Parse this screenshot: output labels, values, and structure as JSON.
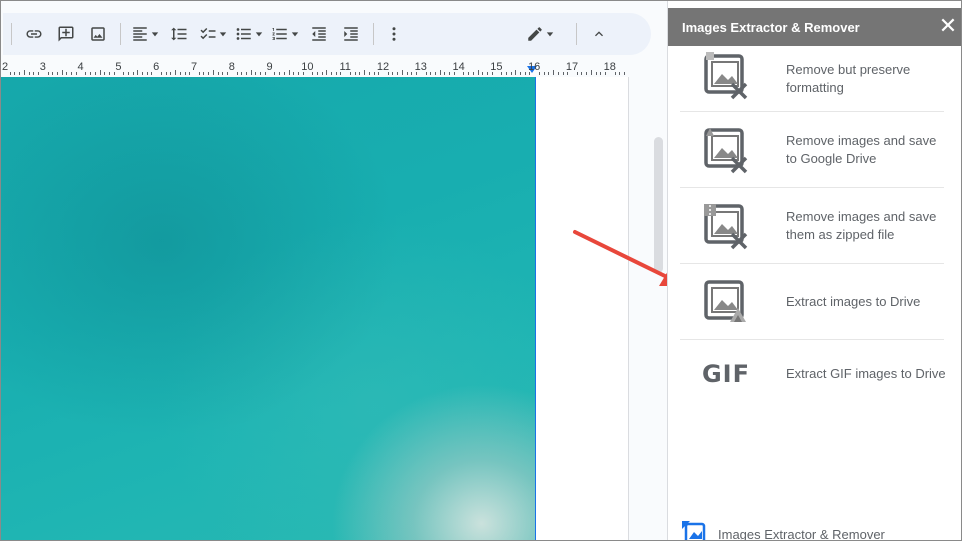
{
  "toolbar": {
    "buttons": [
      {
        "name": "insert-link-button",
        "icon": "link-icon"
      },
      {
        "name": "add-comment-button",
        "icon": "add-comment-icon"
      },
      {
        "name": "insert-image-button",
        "icon": "image-icon"
      },
      {
        "name": "align-button",
        "icon": "align-left-icon"
      },
      {
        "name": "line-spacing-button",
        "icon": "line-spacing-icon"
      },
      {
        "name": "checklist-button",
        "icon": "checklist-icon"
      },
      {
        "name": "bulleted-list-button",
        "icon": "bulleted-list-icon"
      },
      {
        "name": "numbered-list-button",
        "icon": "numbered-list-icon"
      },
      {
        "name": "decrease-indent-button",
        "icon": "decrease-indent-icon"
      },
      {
        "name": "increase-indent-button",
        "icon": "increase-indent-icon"
      },
      {
        "name": "more-options-button",
        "icon": "more-vert-icon"
      },
      {
        "name": "editing-mode-button",
        "icon": "pencil-icon"
      },
      {
        "name": "hide-menus-button",
        "icon": "chevron-up-icon"
      }
    ]
  },
  "ruler": {
    "labels": [
      "2",
      "3",
      "4",
      "5",
      "6",
      "7",
      "8",
      "9",
      "10",
      "11",
      "12",
      "13",
      "14",
      "15",
      "16",
      "17",
      "18"
    ]
  },
  "panel": {
    "title": "Images Extractor & Remover",
    "close_glyph": "✕",
    "items": [
      {
        "label": "Remove but preserve formatting",
        "icon": "image-remove-icon"
      },
      {
        "label": "Remove images and save to Google Drive",
        "icon": "image-remove-drive-icon"
      },
      {
        "label": "Remove images and save them as zipped file",
        "icon": "image-remove-zip-icon"
      },
      {
        "label": "Extract images to Drive",
        "icon": "image-extract-drive-icon"
      },
      {
        "label": "Extract GIF images to Drive",
        "icon": "gif-icon",
        "icon_text": "GIF"
      }
    ],
    "footer_label": "Images Extractor & Remover"
  },
  "colors": {
    "accent": "#1a73e8",
    "panel_header": "#757575",
    "annotation_arrow": "#e8473b",
    "image_teal": "#18aeb0"
  }
}
